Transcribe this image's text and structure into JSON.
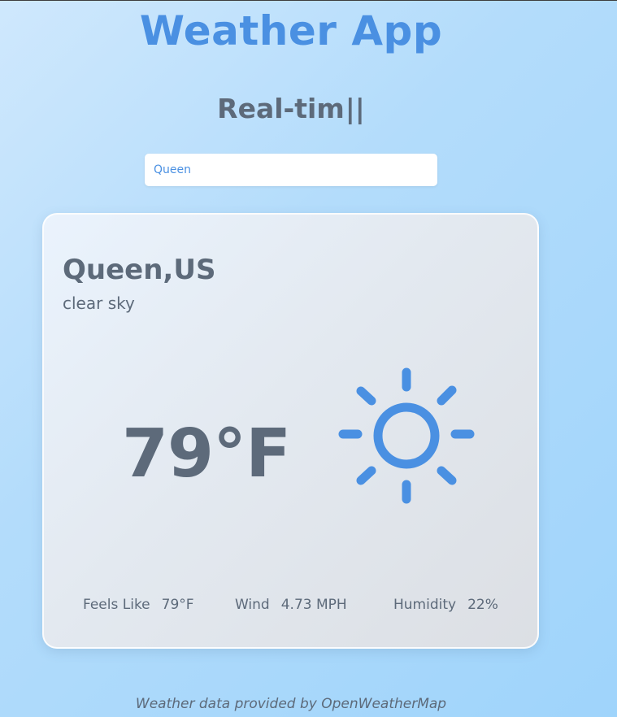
{
  "header": {
    "title": "Weather App",
    "subtitle": "Real-tim",
    "caret": "||"
  },
  "search": {
    "value": "Queen",
    "placeholder": ""
  },
  "weather": {
    "location": "Queen,US",
    "condition": "clear sky",
    "temperature": "79°F",
    "icon": "sun-icon",
    "feels_like_label": "Feels Like",
    "feels_like_value": "79°F",
    "wind_label": "Wind",
    "wind_value": "4.73 MPH",
    "humidity_label": "Humidity",
    "humidity_value": "22%"
  },
  "footer": {
    "text": "Weather data provided by OpenWeatherMap"
  },
  "colors": {
    "accent": "#4a90e2",
    "text": "#5d6a7a"
  }
}
